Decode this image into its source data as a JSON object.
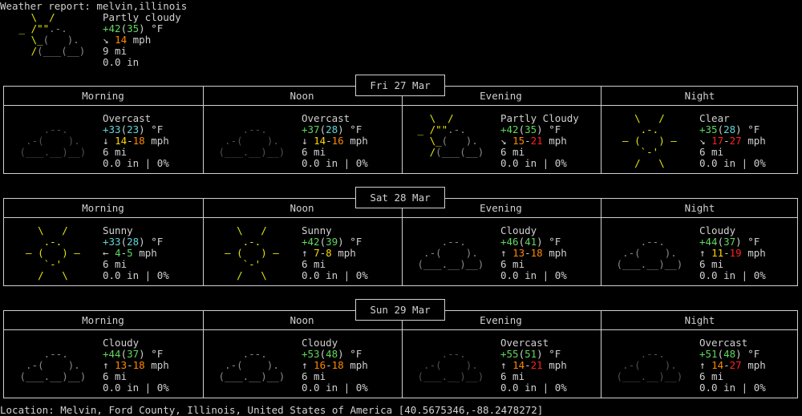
{
  "report_title": "Weather report: melvin,illinois",
  "current": {
    "art_color": "yellow",
    "art_color2": "gray",
    "condition": "Partly cloudy",
    "temp_main": "+42",
    "temp_feels": "35",
    "temp_unit": "°F",
    "wind_arrow": "↘",
    "wind_speed": "14",
    "wind_unit": "mph",
    "visibility": "9 mi",
    "precip": "0.0 in"
  },
  "days": [
    {
      "date": "Fri 27 Mar",
      "periods": [
        {
          "label": "Morning",
          "icon": "overcast",
          "condition": "Overcast",
          "temp_main": "+33",
          "temp_feels": "23",
          "temp_main_color": "cyan",
          "temp_feels_color": "cyan",
          "wind_arrow": "↓",
          "wind_lo": "14",
          "wind_hi": "18",
          "wind_lo_color": "yorange",
          "wind_hi_color": "orange",
          "visibility": "6 mi",
          "precip": "0.0 in | 0%"
        },
        {
          "label": "Noon",
          "icon": "overcast",
          "condition": "Overcast",
          "temp_main": "+37",
          "temp_feels": "28",
          "temp_main_color": "green",
          "temp_feels_color": "cyan",
          "wind_arrow": "↓",
          "wind_lo": "14",
          "wind_hi": "16",
          "wind_lo_color": "yorange",
          "wind_hi_color": "orange",
          "visibility": "6 mi",
          "precip": "0.0 in | 0%"
        },
        {
          "label": "Evening",
          "icon": "partly",
          "condition": "Partly Cloudy",
          "temp_main": "+42",
          "temp_feels": "35",
          "temp_main_color": "green",
          "temp_feels_color": "green",
          "wind_arrow": "↘",
          "wind_lo": "15",
          "wind_hi": "21",
          "wind_lo_color": "orange",
          "wind_hi_color": "red",
          "visibility": "6 mi",
          "precip": "0.0 in | 0%"
        },
        {
          "label": "Night",
          "icon": "clear",
          "condition": "Clear",
          "temp_main": "+35",
          "temp_feels": "28",
          "temp_main_color": "green",
          "temp_feels_color": "cyan",
          "wind_arrow": "↘",
          "wind_lo": "17",
          "wind_hi": "27",
          "wind_lo_color": "red",
          "wind_hi_color": "red",
          "visibility": "6 mi",
          "precip": "0.0 in | 0%"
        }
      ]
    },
    {
      "date": "Sat 28 Mar",
      "periods": [
        {
          "label": "Morning",
          "icon": "sunny",
          "condition": "Sunny",
          "temp_main": "+33",
          "temp_feels": "28",
          "temp_main_color": "cyan",
          "temp_feels_color": "cyan",
          "wind_arrow": "←",
          "wind_lo": "4",
          "wind_hi": "5",
          "wind_lo_color": "green",
          "wind_hi_color": "green",
          "visibility": "6 mi",
          "precip": "0.0 in | 0%"
        },
        {
          "label": "Noon",
          "icon": "sunny",
          "condition": "Sunny",
          "temp_main": "+42",
          "temp_feels": "39",
          "temp_main_color": "green",
          "temp_feels_color": "green",
          "wind_arrow": "↑",
          "wind_lo": "7",
          "wind_hi": "8",
          "wind_lo_color": "yorange",
          "wind_hi_color": "yorange",
          "visibility": "6 mi",
          "precip": "0.0 in | 0%"
        },
        {
          "label": "Evening",
          "icon": "cloudy",
          "condition": "Cloudy",
          "temp_main": "+46",
          "temp_feels": "41",
          "temp_main_color": "green",
          "temp_feels_color": "green",
          "wind_arrow": "↑",
          "wind_lo": "13",
          "wind_hi": "18",
          "wind_lo_color": "orange",
          "wind_hi_color": "orange",
          "visibility": "6 mi",
          "precip": "0.0 in | 0%"
        },
        {
          "label": "Night",
          "icon": "cloudy",
          "condition": "Cloudy",
          "temp_main": "+44",
          "temp_feels": "37",
          "temp_main_color": "green",
          "temp_feels_color": "green",
          "wind_arrow": "↑",
          "wind_lo": "11",
          "wind_hi": "19",
          "wind_lo_color": "yorange",
          "wind_hi_color": "red",
          "visibility": "6 mi",
          "precip": "0.0 in | 0%"
        }
      ]
    },
    {
      "date": "Sun 29 Mar",
      "periods": [
        {
          "label": "Morning",
          "icon": "cloudy",
          "condition": "Cloudy",
          "temp_main": "+44",
          "temp_feels": "37",
          "temp_main_color": "green",
          "temp_feels_color": "green",
          "wind_arrow": "↑",
          "wind_lo": "13",
          "wind_hi": "18",
          "wind_lo_color": "orange",
          "wind_hi_color": "orange",
          "visibility": "6 mi",
          "precip": "0.0 in | 0%"
        },
        {
          "label": "Noon",
          "icon": "cloudy",
          "condition": "Cloudy",
          "temp_main": "+53",
          "temp_feels": "48",
          "temp_main_color": "green",
          "temp_feels_color": "green",
          "wind_arrow": "↑",
          "wind_lo": "16",
          "wind_hi": "18",
          "wind_lo_color": "orange",
          "wind_hi_color": "orange",
          "visibility": "6 mi",
          "precip": "0.0 in | 0%"
        },
        {
          "label": "Evening",
          "icon": "overcast",
          "condition": "Overcast",
          "temp_main": "+55",
          "temp_feels": "51",
          "temp_main_color": "green",
          "temp_feels_color": "green",
          "wind_arrow": "↑",
          "wind_lo": "14",
          "wind_hi": "21",
          "wind_lo_color": "orange",
          "wind_hi_color": "red",
          "visibility": "6 mi",
          "precip": "0.0 in | 0%"
        },
        {
          "label": "Night",
          "icon": "overcast",
          "condition": "Overcast",
          "temp_main": "+51",
          "temp_feels": "48",
          "temp_main_color": "green",
          "temp_feels_color": "green",
          "wind_arrow": "↑",
          "wind_lo": "14",
          "wind_hi": "27",
          "wind_lo_color": "orange",
          "wind_hi_color": "red",
          "visibility": "6 mi",
          "precip": "0.0 in | 0%"
        }
      ]
    }
  ],
  "location": "Location: Melvin, Ford County, Illinois, United States of America [40.5675346,-88.2478272]",
  "colors": {
    "background": "#000000",
    "text": "#d0d0d0",
    "sun": "#e5e510",
    "cloud": "#8a8a8a",
    "overcast_cloud": "#505050",
    "temp_cold": "#5fd7d7",
    "temp_mild": "#5fd75f",
    "wind_low": "#ffd700",
    "wind_mid": "#ff8700",
    "wind_high": "#ff2020"
  }
}
